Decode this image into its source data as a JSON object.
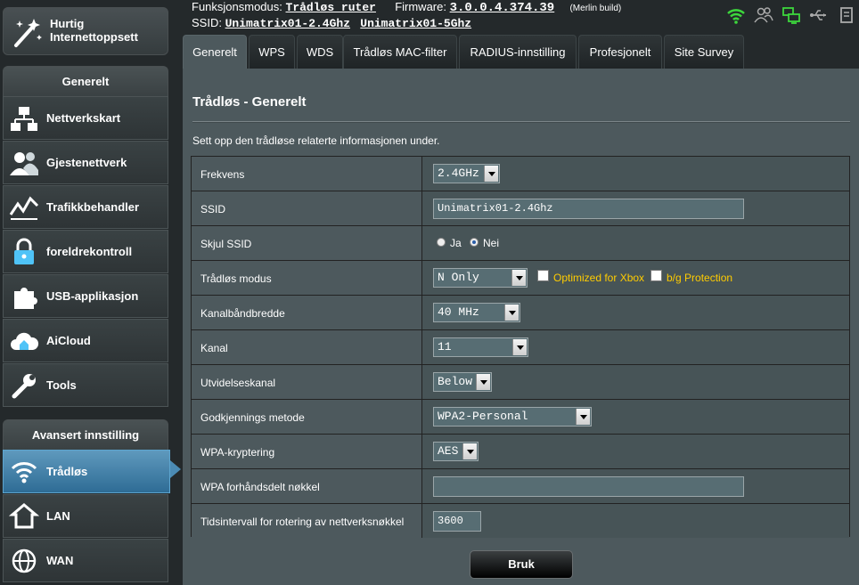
{
  "quick_setup": {
    "label_line1": "Hurtig",
    "label_line2": "Internettoppsett"
  },
  "sidebar": {
    "general_header": "Generelt",
    "general_items": [
      {
        "label": "Nettverkskart",
        "icon": "network-map-icon"
      },
      {
        "label": "Gjestenettverk",
        "icon": "guest-network-icon"
      },
      {
        "label": "Trafikkbehandler",
        "icon": "traffic-manager-icon"
      },
      {
        "label": "foreldrekontroll",
        "icon": "parental-control-icon"
      },
      {
        "label": "USB-applikasjon",
        "icon": "usb-application-icon"
      },
      {
        "label": "AiCloud",
        "icon": "aicloud-icon"
      },
      {
        "label": "Tools",
        "icon": "tools-icon"
      }
    ],
    "advanced_header": "Avansert innstilling",
    "advanced_items": [
      {
        "label": "Trådløs",
        "icon": "wireless-icon",
        "active": true
      },
      {
        "label": "LAN",
        "icon": "lan-icon"
      },
      {
        "label": "WAN",
        "icon": "wan-icon"
      }
    ]
  },
  "top": {
    "mode_label": "Funksjonsmodus:",
    "mode_value": "Trådløs ruter",
    "firmware_label": "Firmware:",
    "firmware_value": "3.0.0.4.374.39",
    "firmware_note": "(Merlin build)",
    "ssid_label": "SSID:",
    "ssid_24": "Unimatrix01-2.4Ghz",
    "ssid_5": "Unimatrix01-5Ghz",
    "status_icons": [
      "wifi-signal-icon",
      "users-icon",
      "network-status-icon",
      "usb-icon",
      "document-icon"
    ]
  },
  "tabs": [
    {
      "label": "Generelt",
      "active": true
    },
    {
      "label": "WPS"
    },
    {
      "label": "WDS"
    },
    {
      "label": "Trådløs MAC-filter"
    },
    {
      "label": "RADIUS-innstilling"
    },
    {
      "label": "Profesjonelt"
    },
    {
      "label": "Site Survey"
    }
  ],
  "content": {
    "title": "Trådløs - Generelt",
    "description": "Sett opp den trådløse relaterte informasjonen under.",
    "fields": {
      "frequency": {
        "label": "Frekvens",
        "value": "2.4GHz"
      },
      "ssid": {
        "label": "SSID",
        "value": "Unimatrix01-2.4Ghz"
      },
      "hide_ssid": {
        "label": "Skjul SSID",
        "options": [
          "Ja",
          "Nei"
        ],
        "selected": "Nei"
      },
      "wireless_mode": {
        "label": "Trådløs modus",
        "value": "N Only",
        "xbox_label": "Optimized for Xbox",
        "bg_label": "b/g Protection"
      },
      "bandwidth": {
        "label": "Kanalbåndbredde",
        "value": "40 MHz"
      },
      "channel": {
        "label": "Kanal",
        "value": "11"
      },
      "ext_channel": {
        "label": "Utvidelseskanal",
        "value": "Below"
      },
      "auth_method": {
        "label": "Godkjennings metode",
        "value": "WPA2-Personal"
      },
      "wpa_encryption": {
        "label": "WPA-kryptering",
        "value": "AES"
      },
      "wpa_psk": {
        "label": "WPA forhåndsdelt nøkkel",
        "value": ""
      },
      "key_rotation": {
        "label": "Tidsintervall for rotering av nettverksnøkkel",
        "value": "3600"
      }
    },
    "apply_button": "Bruk"
  },
  "colors": {
    "accent_active": "#4b8bb4",
    "orange_text": "#ffcc00",
    "wifi_green": "#3cd63c"
  }
}
